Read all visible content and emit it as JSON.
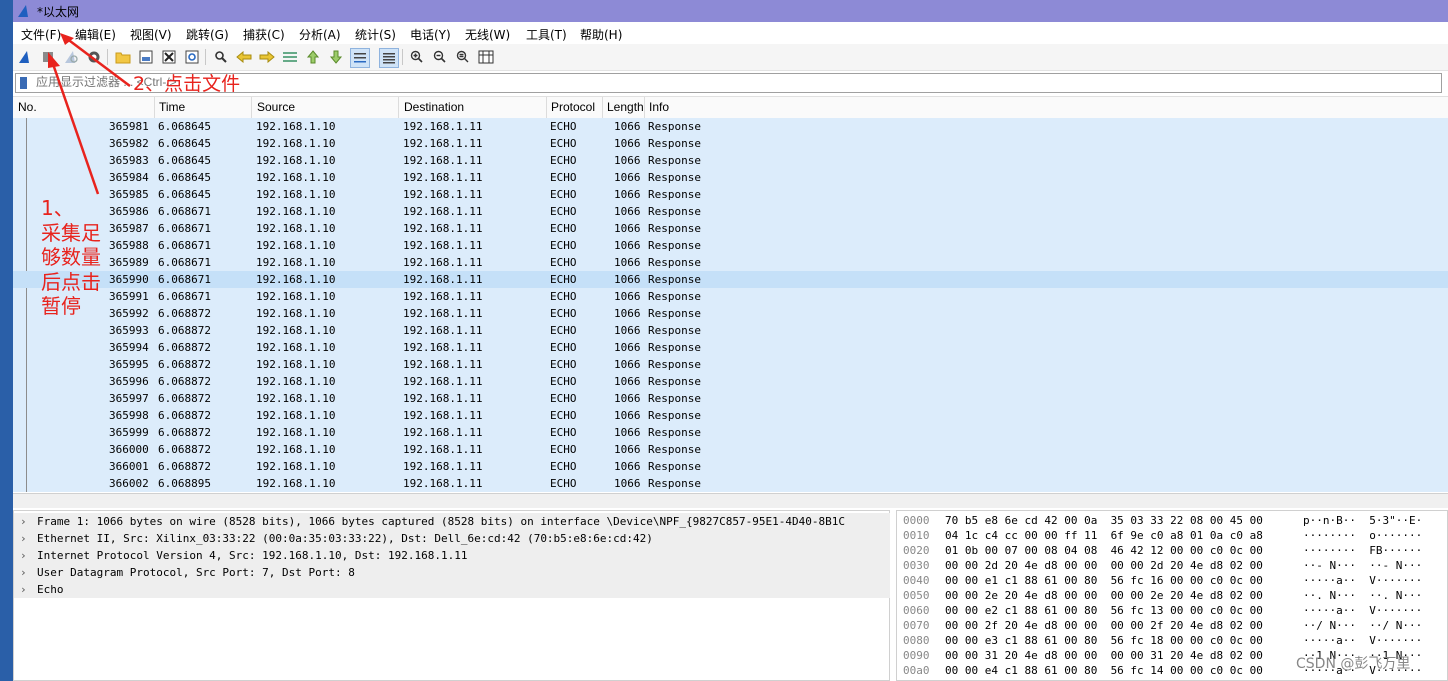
{
  "window": {
    "title": "*以太网"
  },
  "menu": [
    "文件(F)",
    "编辑(E)",
    "视图(V)",
    "跳转(G)",
    "捕获(C)",
    "分析(A)",
    "统计(S)",
    "电话(Y)",
    "无线(W)",
    "工具(T)",
    "帮助(H)"
  ],
  "filter": {
    "placeholder": "应用显示过滤器 ... <Ctrl-/>"
  },
  "columns": [
    "No.",
    "Time",
    "Source",
    "Destination",
    "Protocol",
    "Length",
    "Info"
  ],
  "rows": [
    [
      "365981",
      "6.068645",
      "192.168.1.10",
      "192.168.1.11",
      "ECHO",
      "1066",
      "Response"
    ],
    [
      "365982",
      "6.068645",
      "192.168.1.10",
      "192.168.1.11",
      "ECHO",
      "1066",
      "Response"
    ],
    [
      "365983",
      "6.068645",
      "192.168.1.10",
      "192.168.1.11",
      "ECHO",
      "1066",
      "Response"
    ],
    [
      "365984",
      "6.068645",
      "192.168.1.10",
      "192.168.1.11",
      "ECHO",
      "1066",
      "Response"
    ],
    [
      "365985",
      "6.068645",
      "192.168.1.10",
      "192.168.1.11",
      "ECHO",
      "1066",
      "Response"
    ],
    [
      "365986",
      "6.068671",
      "192.168.1.10",
      "192.168.1.11",
      "ECHO",
      "1066",
      "Response"
    ],
    [
      "365987",
      "6.068671",
      "192.168.1.10",
      "192.168.1.11",
      "ECHO",
      "1066",
      "Response"
    ],
    [
      "365988",
      "6.068671",
      "192.168.1.10",
      "192.168.1.11",
      "ECHO",
      "1066",
      "Response"
    ],
    [
      "365989",
      "6.068671",
      "192.168.1.10",
      "192.168.1.11",
      "ECHO",
      "1066",
      "Response"
    ],
    [
      "365990",
      "6.068671",
      "192.168.1.10",
      "192.168.1.11",
      "ECHO",
      "1066",
      "Response"
    ],
    [
      "365991",
      "6.068671",
      "192.168.1.10",
      "192.168.1.11",
      "ECHO",
      "1066",
      "Response"
    ],
    [
      "365992",
      "6.068872",
      "192.168.1.10",
      "192.168.1.11",
      "ECHO",
      "1066",
      "Response"
    ],
    [
      "365993",
      "6.068872",
      "192.168.1.10",
      "192.168.1.11",
      "ECHO",
      "1066",
      "Response"
    ],
    [
      "365994",
      "6.068872",
      "192.168.1.10",
      "192.168.1.11",
      "ECHO",
      "1066",
      "Response"
    ],
    [
      "365995",
      "6.068872",
      "192.168.1.10",
      "192.168.1.11",
      "ECHO",
      "1066",
      "Response"
    ],
    [
      "365996",
      "6.068872",
      "192.168.1.10",
      "192.168.1.11",
      "ECHO",
      "1066",
      "Response"
    ],
    [
      "365997",
      "6.068872",
      "192.168.1.10",
      "192.168.1.11",
      "ECHO",
      "1066",
      "Response"
    ],
    [
      "365998",
      "6.068872",
      "192.168.1.10",
      "192.168.1.11",
      "ECHO",
      "1066",
      "Response"
    ],
    [
      "365999",
      "6.068872",
      "192.168.1.10",
      "192.168.1.11",
      "ECHO",
      "1066",
      "Response"
    ],
    [
      "366000",
      "6.068872",
      "192.168.1.10",
      "192.168.1.11",
      "ECHO",
      "1066",
      "Response"
    ],
    [
      "366001",
      "6.068872",
      "192.168.1.10",
      "192.168.1.11",
      "ECHO",
      "1066",
      "Response"
    ],
    [
      "366002",
      "6.068895",
      "192.168.1.10",
      "192.168.1.11",
      "ECHO",
      "1066",
      "Response"
    ]
  ],
  "selected_row": "365990",
  "details": [
    "Frame 1: 1066 bytes on wire (8528 bits), 1066 bytes captured (8528 bits) on interface \\Device\\NPF_{9827C857-95E1-4D40-8B1C",
    "Ethernet II, Src: Xilinx_03:33:22 (00:0a:35:03:33:22), Dst: Dell_6e:cd:42 (70:b5:e8:6e:cd:42)",
    "Internet Protocol Version 4, Src: 192.168.1.10, Dst: 192.168.1.11",
    "User Datagram Protocol, Src Port: 7, Dst Port: 8",
    "Echo"
  ],
  "bytes": [
    {
      "off": "0000",
      "hex": "70 b5 e8 6e cd 42 00 0a  35 03 33 22 08 00 45 00",
      "ascii": "p··n·B··  5·3\"··E·"
    },
    {
      "off": "0010",
      "hex": "04 1c c4 cc 00 00 ff 11  6f 9e c0 a8 01 0a c0 a8",
      "ascii": "········  o·······"
    },
    {
      "off": "0020",
      "hex": "01 0b 00 07 00 08 04 08  46 42 12 00 00 c0 0c 00",
      "ascii": "········  FB······"
    },
    {
      "off": "0030",
      "hex": "00 00 2d 20 4e d8 00 00  00 00 2d 20 4e d8 02 00",
      "ascii": "··- N···  ··- N···"
    },
    {
      "off": "0040",
      "hex": "00 00 e1 c1 88 61 00 80  56 fc 16 00 00 c0 0c 00",
      "ascii": "·····a··  V·······"
    },
    {
      "off": "0050",
      "hex": "00 00 2e 20 4e d8 00 00  00 00 2e 20 4e d8 02 00",
      "ascii": "··. N···  ··. N···"
    },
    {
      "off": "0060",
      "hex": "00 00 e2 c1 88 61 00 80  56 fc 13 00 00 c0 0c 00",
      "ascii": "·····a··  V·······"
    },
    {
      "off": "0070",
      "hex": "00 00 2f 20 4e d8 00 00  00 00 2f 20 4e d8 02 00",
      "ascii": "··/ N···  ··/ N···"
    },
    {
      "off": "0080",
      "hex": "00 00 e3 c1 88 61 00 80  56 fc 18 00 00 c0 0c 00",
      "ascii": "·····a··  V·······"
    },
    {
      "off": "0090",
      "hex": "00 00 31 20 4e d8 00 00  00 00 31 20 4e d8 02 00",
      "ascii": "··1 N···  ··1 N···"
    },
    {
      "off": "00a0",
      "hex": "00 00 e4 c1 88 61 00 80  56 fc 14 00 00 c0 0c 00",
      "ascii": "·····a··  V·······"
    }
  ],
  "annotations": {
    "step1": [
      "1、",
      "采集足",
      "够数量",
      "后点击",
      "暂停"
    ],
    "step2": "2、点击文件"
  },
  "watermark": "CSDN @彭飞万里",
  "toolbar_icons": [
    "shark-fin-start-icon",
    "stop-square-icon",
    "restart-icon",
    "options-gear-icon",
    "open-folder-icon",
    "save-file-icon",
    "close-file-icon",
    "reload-icon",
    "find-magnifier-icon",
    "back-arrow-icon",
    "forward-arrow-icon",
    "goto-packet-icon",
    "first-packet-icon",
    "last-packet-icon",
    "autoscroll-icon",
    "colorize-icon",
    "zoom-in-icon",
    "zoom-out-icon",
    "zoom-normal-icon",
    "resize-columns-icon"
  ],
  "colors": {
    "title_bar": "#8d8ad6",
    "row_bg": "#dcecfb",
    "row_selected": "#c5e0f8",
    "annotation": "#e8231d"
  }
}
